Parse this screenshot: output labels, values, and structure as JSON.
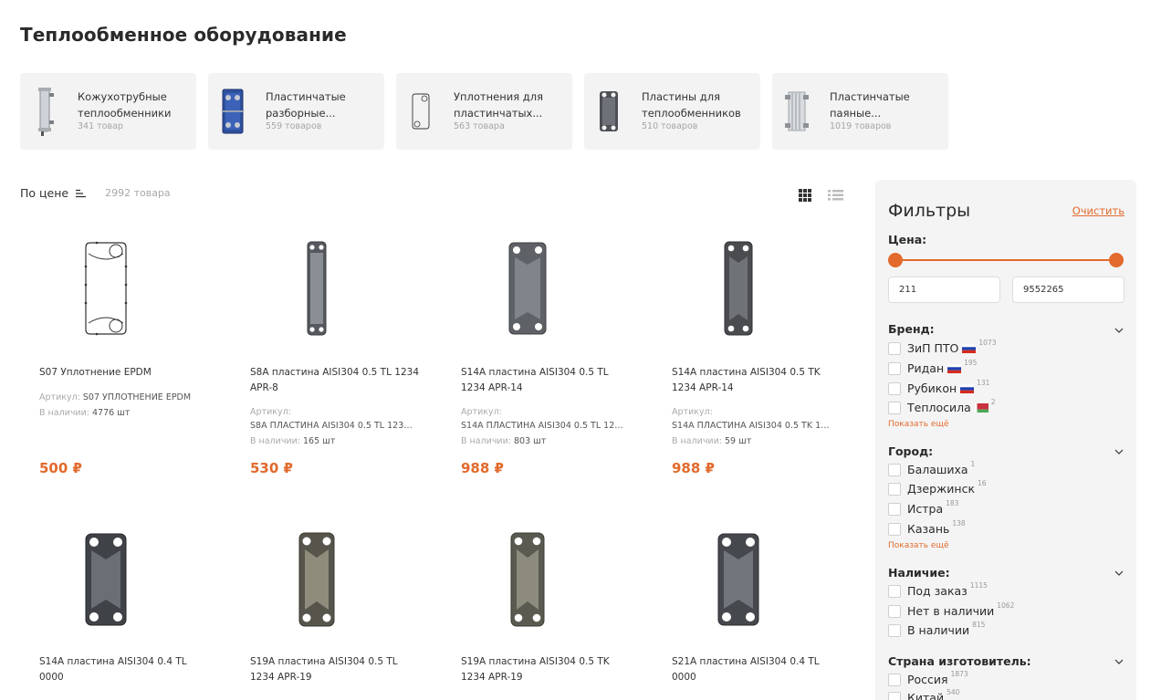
{
  "page": {
    "title": "Теплообменное оборудование"
  },
  "categories": [
    {
      "name": "Кожухотрубные теплообменники",
      "count": "341 товар",
      "icon": "shell-tube-exchanger-icon"
    },
    {
      "name": "Пластинчатые разборные...",
      "count": "559 товаров",
      "icon": "plate-exchanger-icon"
    },
    {
      "name": "Уплотнения для пластинчатых...",
      "count": "563 товара",
      "icon": "gasket-icon"
    },
    {
      "name": "Пластины для теплообменников",
      "count": "510 товаров",
      "icon": "plate-icon"
    },
    {
      "name": "Пластинчатые паяные...",
      "count": "1019 товаров",
      "icon": "brazed-exchanger-icon"
    }
  ],
  "sort": {
    "label": "По цене",
    "total": "2992 товара"
  },
  "products": [
    {
      "title": "S07 Уплотнение EPDM",
      "art_label": "Артикул:",
      "art_value": "S07 УПЛОТНЕНИЕ EPDM",
      "stock_label": "В наличии:",
      "stock_value": "4776 шт",
      "price": "500 ₽"
    },
    {
      "title": "S8A пластина AISI304 0.5 TL 1234 APR-8",
      "art_label": "Артикул:",
      "art_value": "S8A ПЛАСТИНА AISI304 0.5 TL 1234 APR-8",
      "stock_label": "В наличии:",
      "stock_value": "165 шт",
      "price": "530 ₽"
    },
    {
      "title": "S14A пластина AISI304 0.5 TL 1234 APR-14",
      "art_label": "Артикул:",
      "art_value": "S14A ПЛАСТИНА AISI304 0.5 TL 1234 APR-14",
      "stock_label": "В наличии:",
      "stock_value": "803 шт",
      "price": "988 ₽"
    },
    {
      "title": "S14A пластина AISI304 0.5 TK 1234 APR-14",
      "art_label": "Артикул:",
      "art_value": "S14A ПЛАСТИНА AISI304 0.5 TK 1234 APR-14",
      "stock_label": "В наличии:",
      "stock_value": "59 шт",
      "price": "988 ₽"
    },
    {
      "title": "S14A пластина AISI304 0.4 TL 0000"
    },
    {
      "title": "S19A пластина AISI304 0.5 TL 1234 APR-19"
    },
    {
      "title": "S19A пластина AISI304 0.5 TK 1234 APR-19"
    },
    {
      "title": "S21A пластина AISI304 0.4 TL 0000"
    }
  ],
  "filters": {
    "title": "Фильтры",
    "clear": "Очистить",
    "price": {
      "title": "Цена:",
      "min": "211",
      "max": "9552265"
    },
    "brand": {
      "title": "Бренд:",
      "options": [
        {
          "label": "ЗиП ПТО",
          "count": "1073",
          "flag": "ru"
        },
        {
          "label": "Ридан",
          "count": "195",
          "flag": "ru"
        },
        {
          "label": "Рубикон",
          "count": "131",
          "flag": "ru"
        },
        {
          "label": "Теплосила",
          "count": "2",
          "flag": "by"
        }
      ],
      "more": "Показать ещё"
    },
    "city": {
      "title": "Город:",
      "options": [
        {
          "label": "Балашиха",
          "count": "1"
        },
        {
          "label": "Дзержинск",
          "count": "16"
        },
        {
          "label": "Истра",
          "count": "183"
        },
        {
          "label": "Казань",
          "count": "138"
        }
      ],
      "more": "Показать ещё"
    },
    "availability": {
      "title": "Наличие:",
      "options": [
        {
          "label": "Под заказ",
          "count": "1115"
        },
        {
          "label": "Нет в наличии",
          "count": "1062"
        },
        {
          "label": "В наличии",
          "count": "815"
        }
      ]
    },
    "country": {
      "title": "Страна изготовитель:",
      "options": [
        {
          "label": "Россия",
          "count": "1873"
        },
        {
          "label": "Китай",
          "count": "540"
        }
      ]
    }
  },
  "colors": {
    "accent": "#e26a2c",
    "card_bg": "#f3f3f3",
    "filter_bg": "#f4f4f4"
  }
}
